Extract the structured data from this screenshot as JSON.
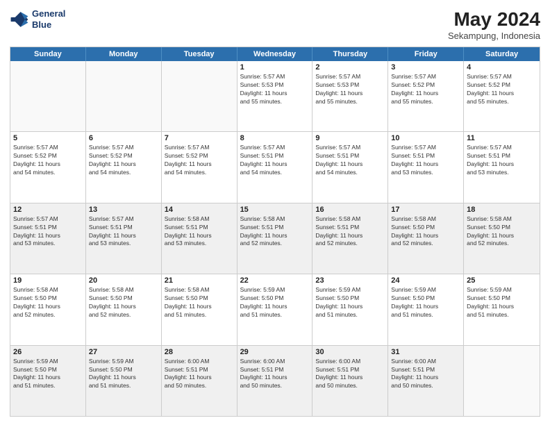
{
  "logo": {
    "line1": "General",
    "line2": "Blue"
  },
  "title": "May 2024",
  "subtitle": "Sekampung, Indonesia",
  "days": [
    "Sunday",
    "Monday",
    "Tuesday",
    "Wednesday",
    "Thursday",
    "Friday",
    "Saturday"
  ],
  "weeks": [
    [
      {
        "day": "",
        "empty": true
      },
      {
        "day": "",
        "empty": true
      },
      {
        "day": "",
        "empty": true
      },
      {
        "day": "1",
        "lines": [
          "Sunrise: 5:57 AM",
          "Sunset: 5:53 PM",
          "Daylight: 11 hours",
          "and 55 minutes."
        ]
      },
      {
        "day": "2",
        "lines": [
          "Sunrise: 5:57 AM",
          "Sunset: 5:53 PM",
          "Daylight: 11 hours",
          "and 55 minutes."
        ]
      },
      {
        "day": "3",
        "lines": [
          "Sunrise: 5:57 AM",
          "Sunset: 5:52 PM",
          "Daylight: 11 hours",
          "and 55 minutes."
        ]
      },
      {
        "day": "4",
        "lines": [
          "Sunrise: 5:57 AM",
          "Sunset: 5:52 PM",
          "Daylight: 11 hours",
          "and 55 minutes."
        ]
      }
    ],
    [
      {
        "day": "5",
        "lines": [
          "Sunrise: 5:57 AM",
          "Sunset: 5:52 PM",
          "Daylight: 11 hours",
          "and 54 minutes."
        ]
      },
      {
        "day": "6",
        "lines": [
          "Sunrise: 5:57 AM",
          "Sunset: 5:52 PM",
          "Daylight: 11 hours",
          "and 54 minutes."
        ]
      },
      {
        "day": "7",
        "lines": [
          "Sunrise: 5:57 AM",
          "Sunset: 5:52 PM",
          "Daylight: 11 hours",
          "and 54 minutes."
        ]
      },
      {
        "day": "8",
        "lines": [
          "Sunrise: 5:57 AM",
          "Sunset: 5:51 PM",
          "Daylight: 11 hours",
          "and 54 minutes."
        ]
      },
      {
        "day": "9",
        "lines": [
          "Sunrise: 5:57 AM",
          "Sunset: 5:51 PM",
          "Daylight: 11 hours",
          "and 54 minutes."
        ]
      },
      {
        "day": "10",
        "lines": [
          "Sunrise: 5:57 AM",
          "Sunset: 5:51 PM",
          "Daylight: 11 hours",
          "and 53 minutes."
        ]
      },
      {
        "day": "11",
        "lines": [
          "Sunrise: 5:57 AM",
          "Sunset: 5:51 PM",
          "Daylight: 11 hours",
          "and 53 minutes."
        ]
      }
    ],
    [
      {
        "day": "12",
        "lines": [
          "Sunrise: 5:57 AM",
          "Sunset: 5:51 PM",
          "Daylight: 11 hours",
          "and 53 minutes."
        ],
        "shaded": true
      },
      {
        "day": "13",
        "lines": [
          "Sunrise: 5:57 AM",
          "Sunset: 5:51 PM",
          "Daylight: 11 hours",
          "and 53 minutes."
        ],
        "shaded": true
      },
      {
        "day": "14",
        "lines": [
          "Sunrise: 5:58 AM",
          "Sunset: 5:51 PM",
          "Daylight: 11 hours",
          "and 53 minutes."
        ],
        "shaded": true
      },
      {
        "day": "15",
        "lines": [
          "Sunrise: 5:58 AM",
          "Sunset: 5:51 PM",
          "Daylight: 11 hours",
          "and 52 minutes."
        ],
        "shaded": true
      },
      {
        "day": "16",
        "lines": [
          "Sunrise: 5:58 AM",
          "Sunset: 5:51 PM",
          "Daylight: 11 hours",
          "and 52 minutes."
        ],
        "shaded": true
      },
      {
        "day": "17",
        "lines": [
          "Sunrise: 5:58 AM",
          "Sunset: 5:50 PM",
          "Daylight: 11 hours",
          "and 52 minutes."
        ],
        "shaded": true
      },
      {
        "day": "18",
        "lines": [
          "Sunrise: 5:58 AM",
          "Sunset: 5:50 PM",
          "Daylight: 11 hours",
          "and 52 minutes."
        ],
        "shaded": true
      }
    ],
    [
      {
        "day": "19",
        "lines": [
          "Sunrise: 5:58 AM",
          "Sunset: 5:50 PM",
          "Daylight: 11 hours",
          "and 52 minutes."
        ]
      },
      {
        "day": "20",
        "lines": [
          "Sunrise: 5:58 AM",
          "Sunset: 5:50 PM",
          "Daylight: 11 hours",
          "and 52 minutes."
        ]
      },
      {
        "day": "21",
        "lines": [
          "Sunrise: 5:58 AM",
          "Sunset: 5:50 PM",
          "Daylight: 11 hours",
          "and 51 minutes."
        ]
      },
      {
        "day": "22",
        "lines": [
          "Sunrise: 5:59 AM",
          "Sunset: 5:50 PM",
          "Daylight: 11 hours",
          "and 51 minutes."
        ]
      },
      {
        "day": "23",
        "lines": [
          "Sunrise: 5:59 AM",
          "Sunset: 5:50 PM",
          "Daylight: 11 hours",
          "and 51 minutes."
        ]
      },
      {
        "day": "24",
        "lines": [
          "Sunrise: 5:59 AM",
          "Sunset: 5:50 PM",
          "Daylight: 11 hours",
          "and 51 minutes."
        ]
      },
      {
        "day": "25",
        "lines": [
          "Sunrise: 5:59 AM",
          "Sunset: 5:50 PM",
          "Daylight: 11 hours",
          "and 51 minutes."
        ]
      }
    ],
    [
      {
        "day": "26",
        "lines": [
          "Sunrise: 5:59 AM",
          "Sunset: 5:50 PM",
          "Daylight: 11 hours",
          "and 51 minutes."
        ],
        "shaded": true
      },
      {
        "day": "27",
        "lines": [
          "Sunrise: 5:59 AM",
          "Sunset: 5:50 PM",
          "Daylight: 11 hours",
          "and 51 minutes."
        ],
        "shaded": true
      },
      {
        "day": "28",
        "lines": [
          "Sunrise: 6:00 AM",
          "Sunset: 5:51 PM",
          "Daylight: 11 hours",
          "and 50 minutes."
        ],
        "shaded": true
      },
      {
        "day": "29",
        "lines": [
          "Sunrise: 6:00 AM",
          "Sunset: 5:51 PM",
          "Daylight: 11 hours",
          "and 50 minutes."
        ],
        "shaded": true
      },
      {
        "day": "30",
        "lines": [
          "Sunrise: 6:00 AM",
          "Sunset: 5:51 PM",
          "Daylight: 11 hours",
          "and 50 minutes."
        ],
        "shaded": true
      },
      {
        "day": "31",
        "lines": [
          "Sunrise: 6:00 AM",
          "Sunset: 5:51 PM",
          "Daylight: 11 hours",
          "and 50 minutes."
        ],
        "shaded": true
      },
      {
        "day": "",
        "empty": true,
        "shaded": true
      }
    ]
  ]
}
